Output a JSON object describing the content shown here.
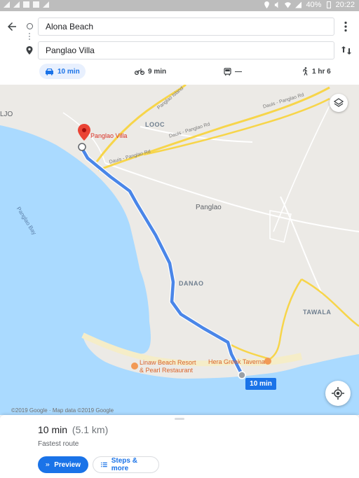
{
  "status_bar": {
    "battery": "40%",
    "time": "20:22"
  },
  "header": {
    "origin": "Alona Beach",
    "destination": "Panglao Villa",
    "modes": [
      {
        "icon": "car-icon",
        "label": "10 min",
        "active": true
      },
      {
        "icon": "motorcycle-icon",
        "label": "9 min",
        "active": false
      },
      {
        "icon": "transit-icon",
        "label": "—",
        "active": false
      },
      {
        "icon": "walk-icon",
        "label": "1 hr 6",
        "active": false
      }
    ]
  },
  "map": {
    "labels": {
      "ljo": "LJO",
      "looc": "LOOC",
      "panglao": "Panglao",
      "danao": "DANAO",
      "tawala": "TAWALA",
      "panglao_bay": "Panglao Bay",
      "dauis_panglao_rd_1": "Dauis - Panglao Rd",
      "dauis_panglao_rd_2": "Dauis - Panglao Rd",
      "dauis_panglao_rd_3": "Dauis - Panglao Rd",
      "panglao_island": "Panglao Island",
      "destination_pin": "Panglao Villa",
      "poi_linaw_1": "Linaw Beach Resort",
      "poi_linaw_2": "& Pearl Restaurant",
      "poi_hera": "Hera Greek Taverna"
    },
    "route_chip": "10 min",
    "copyright": "©2019 Google · Map data ©2019 Google"
  },
  "sheet": {
    "duration": "10 min",
    "distance": "(5.1 km)",
    "subtitle": "Fastest route",
    "preview_button": "Preview",
    "steps_button": "Steps & more"
  },
  "colors": {
    "accent": "#1a73e8",
    "route": "#4a86e8",
    "water": "#aadaff",
    "land": "#eceae6",
    "road_yellow": "#f7d54a",
    "pin_red": "#ea4335"
  }
}
